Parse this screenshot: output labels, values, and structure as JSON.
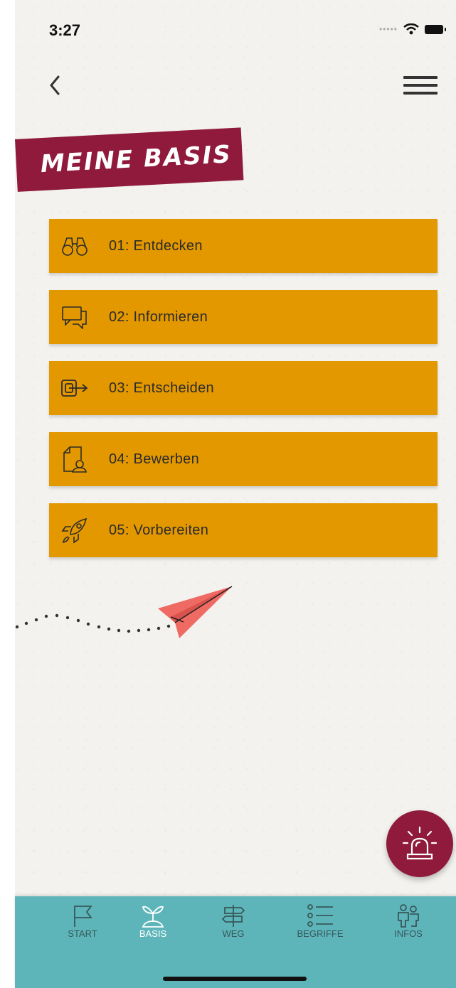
{
  "status": {
    "time": "3:27",
    "signal_icon": "signal-dots-icon",
    "wifi_icon": "wifi-icon",
    "battery_icon": "battery-icon"
  },
  "nav": {
    "back_icon": "chevron-left-icon",
    "menu_icon": "hamburger-menu-icon"
  },
  "page": {
    "title": "MEINE BASIS"
  },
  "menu": [
    {
      "label": "01: Entdecken",
      "icon": "binoculars-icon"
    },
    {
      "label": "02: Informieren",
      "icon": "chat-bubbles-icon"
    },
    {
      "label": "03: Entscheiden",
      "icon": "decision-arrow-icon"
    },
    {
      "label": "04: Bewerben",
      "icon": "document-person-icon"
    },
    {
      "label": "05: Vorbereiten",
      "icon": "rocket-icon"
    }
  ],
  "alarm": {
    "icon": "siren-icon"
  },
  "tabs": [
    {
      "label": "START",
      "icon": "flag-icon",
      "active": false
    },
    {
      "label": "BASIS",
      "icon": "sprout-icon",
      "active": true
    },
    {
      "label": "WEG",
      "icon": "signpost-icon",
      "active": false
    },
    {
      "label": "BEGRIFFE",
      "icon": "list-icon",
      "active": false
    },
    {
      "label": "INFOS",
      "icon": "people-icon",
      "active": false
    }
  ],
  "colors": {
    "accent": "#e39800",
    "brand": "#8f1a3c",
    "tabbar": "#5eb5b9",
    "plane": "#ef6a63"
  }
}
